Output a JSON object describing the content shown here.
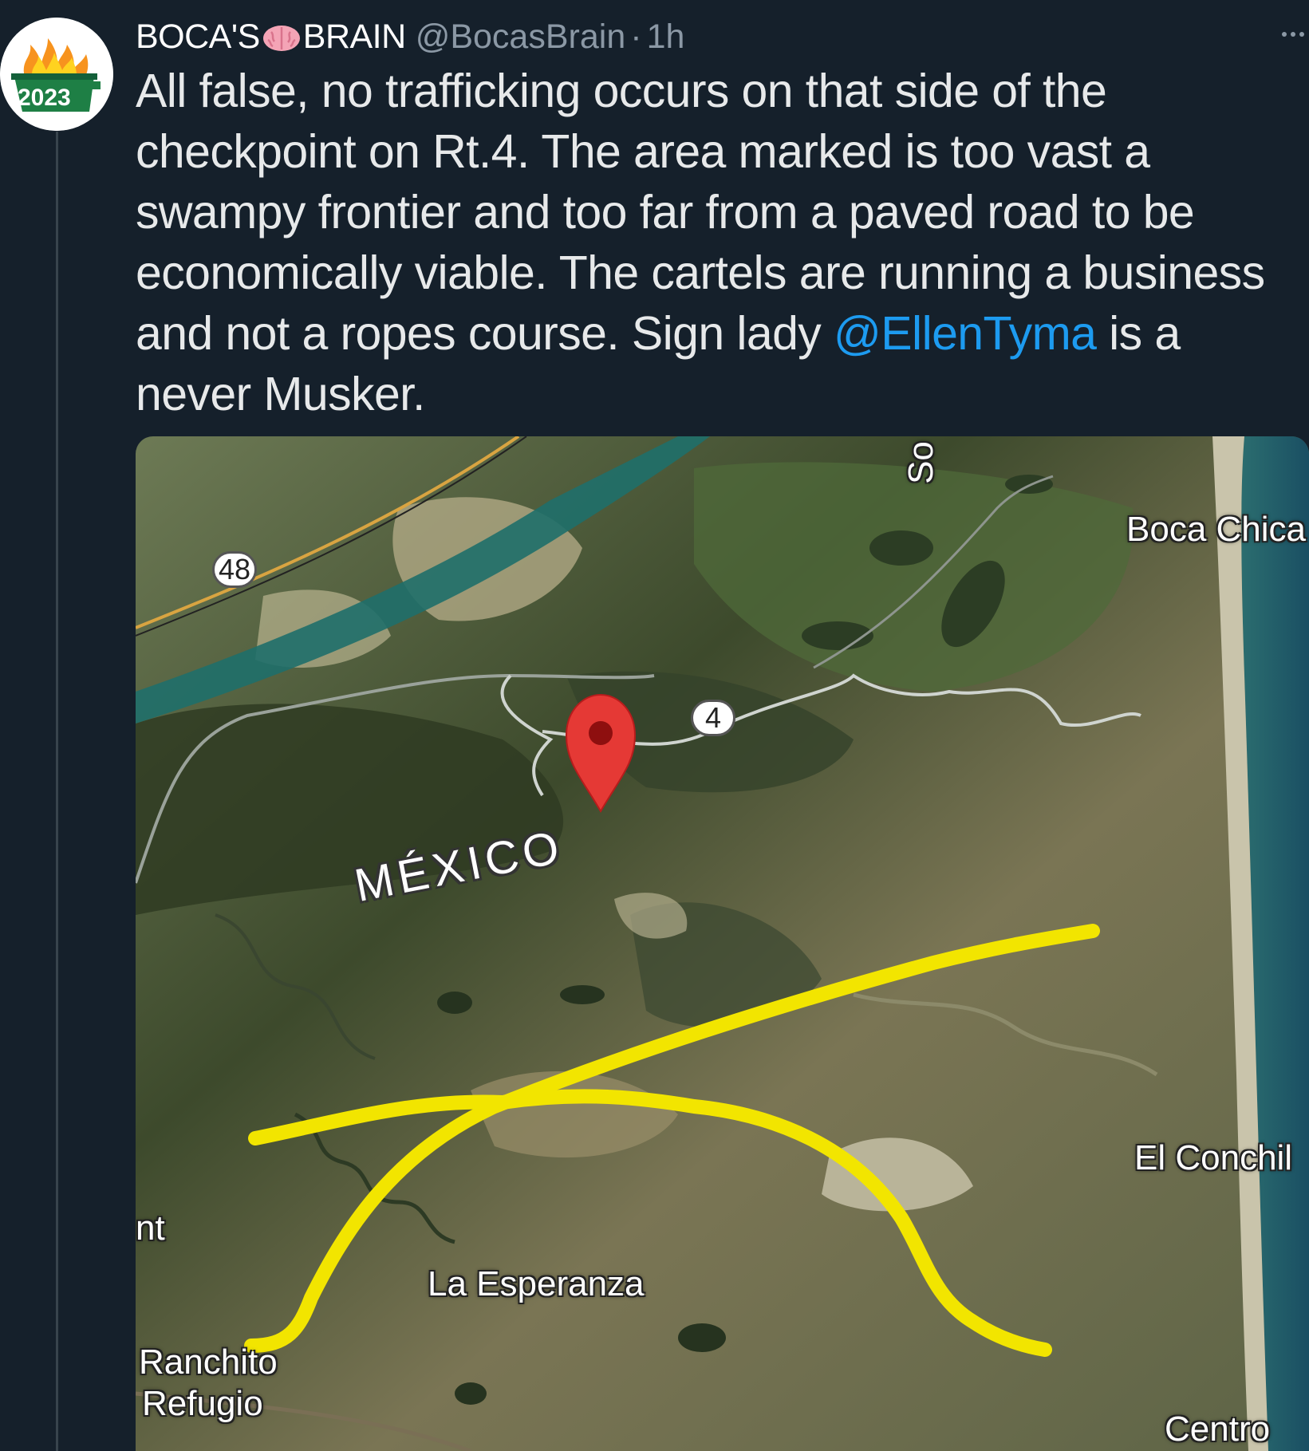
{
  "tweet": {
    "display_name": "BOCA'S",
    "display_name_suffix": "BRAIN",
    "handle": "@BocasBrain",
    "separator": "·",
    "timestamp": "1h",
    "avatar_label": "2023",
    "text_before_mention": "All false, no trafficking occurs on that side of the checkpoint on Rt.4. The area marked is too vast a swampy frontier and too far from a paved road to be economically viable. The cartels are running a business and not a ropes course. Sign lady ",
    "mention": "@EllenTyma",
    "text_after_mention": " is a never Musker."
  },
  "map": {
    "route_48": "48",
    "route_4": "4",
    "country": "MÉXICO",
    "labels": {
      "boca_chica": "Boca Chica",
      "el_conchil": "El Conchil",
      "la_esperanza": "La Esperanza",
      "ranchito": "Ranchito",
      "refugio": "Refugio",
      "centro": "Centro",
      "partial_left": "nt",
      "partial_top": "So"
    },
    "colors": {
      "marker": "#e53935",
      "highlight": "#f2e500",
      "water": "#1f6f7a"
    },
    "icons": [
      "location-pin-icon",
      "more-options-icon",
      "brain-emoji-icon",
      "dumpster-fire-icon"
    ]
  }
}
